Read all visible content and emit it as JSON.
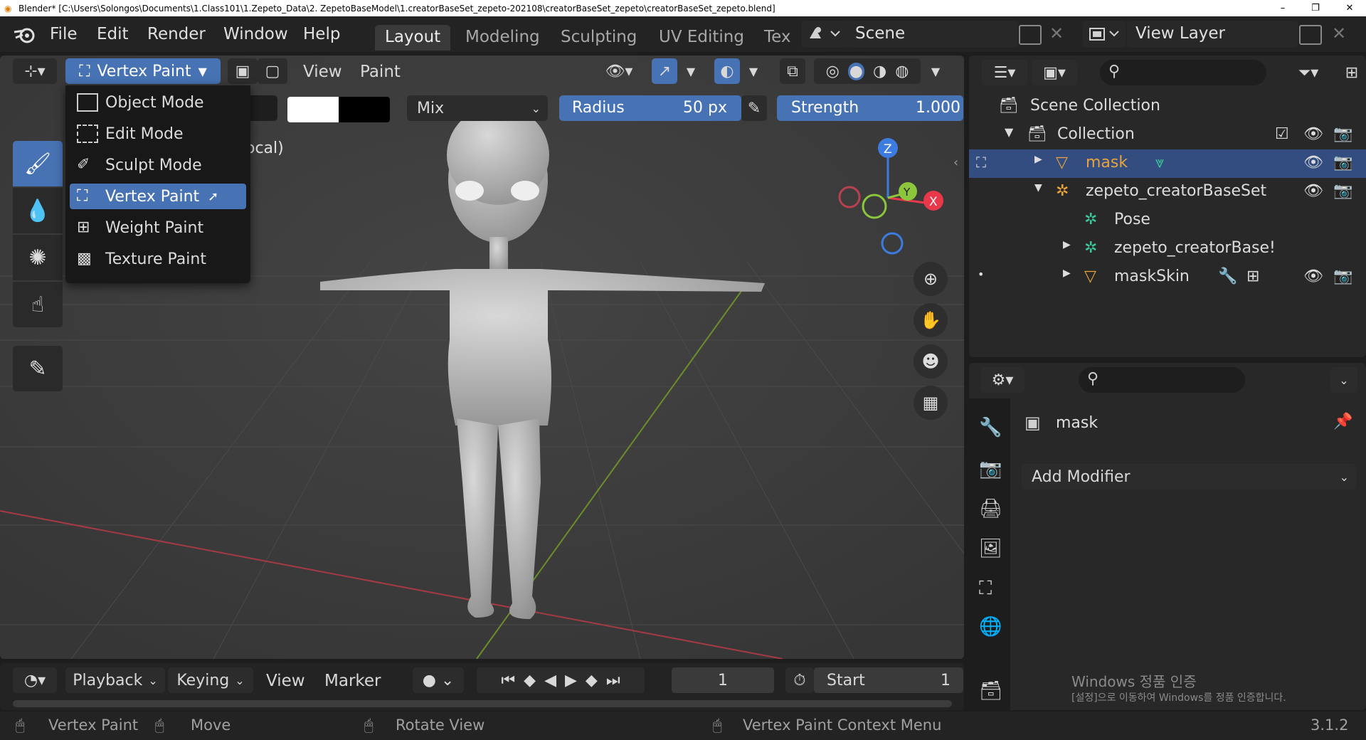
{
  "titlebar": {
    "title": "Blender* [C:\\Users\\Solongos\\Documents\\1.Class101\\1.Zepeto_Data\\2. ZepetoBaseModel\\1.creatorBaseSet_zepeto-202108\\creatorBaseSet_zepeto\\creatorBaseSet_zepeto.blend]",
    "minimize": "–",
    "restore": "❐",
    "close": "✕"
  },
  "menubar": {
    "items": [
      "File",
      "Edit",
      "Render",
      "Window",
      "Help"
    ]
  },
  "workspaces": [
    "Layout",
    "Modeling",
    "Sculpting",
    "UV Editing",
    "Tex"
  ],
  "scene": {
    "label": "Scene"
  },
  "view_layer": {
    "label": "View Layer"
  },
  "viewport_header": {
    "mode_label": "Vertex Paint",
    "view_menu": "View",
    "paint_menu": "Paint",
    "blend_mode": "Mix",
    "radius_label": "Radius",
    "radius_value": "50 px",
    "strength_label": "Strength",
    "strength_value": "1.000",
    "overlay_text": "ocal)"
  },
  "mode_menu": {
    "items": [
      "Object Mode",
      "Edit Mode",
      "Sculpt Mode",
      "Vertex Paint",
      "Weight Paint",
      "Texture Paint"
    ],
    "active": "Vertex Paint"
  },
  "gizmo": {
    "z": "Z",
    "y": "Y",
    "x": "X"
  },
  "outliner": {
    "scene_collection": "Scene Collection",
    "collection": "Collection",
    "rows": [
      {
        "name": "mask"
      },
      {
        "name": "zepeto_creatorBaseSet"
      },
      {
        "name": "Pose"
      },
      {
        "name": "zepeto_creatorBase!"
      },
      {
        "name": "maskSkin"
      }
    ]
  },
  "properties": {
    "object_name": "mask",
    "add_modifier": "Add Modifier",
    "watermark_title": "Windows 정품 인증",
    "watermark_sub": "[설정]으로 이동하여 Windows를 정품 인증합니다."
  },
  "timeline": {
    "playback": "Playback",
    "keying": "Keying",
    "view": "View",
    "marker": "Marker",
    "current_frame": "1",
    "start_label": "Start",
    "start_value": "1"
  },
  "statusbar": {
    "left_action": "Vertex Paint",
    "middle_action": "Move",
    "rotate": "Rotate View",
    "context": "Vertex Paint Context Menu",
    "version": "3.1.2"
  },
  "colors": {
    "accent": "#4772b3",
    "selected_row": "#334d80",
    "object_orange": "#e8a33c",
    "axis_x": "#e8384a",
    "axis_y": "#8cc63c",
    "axis_z": "#3c7ce0"
  }
}
